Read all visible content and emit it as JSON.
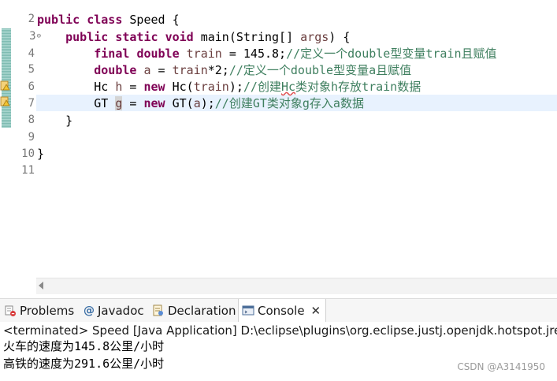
{
  "editor": {
    "line_numbers": [
      "2",
      "3",
      "4",
      "5",
      "6",
      "7",
      "8",
      "9",
      "10",
      "11"
    ],
    "lines": {
      "l2": {
        "kw1": "public",
        "kw2": "class",
        "rest": " Speed {"
      },
      "l3": {
        "indent": "    ",
        "kw1": "public",
        "kw2": "static",
        "kw3": "void",
        "rest": " main(String[] ",
        "param": "args",
        "tail": ") {"
      },
      "l4": {
        "indent": "        ",
        "kw1": "final",
        "kw2": "double",
        "var": "train",
        "mid": " = 145.8;",
        "comment": "//定义一个double型变量train且赋值"
      },
      "l5": {
        "indent": "        ",
        "kw1": "double",
        "var": "a",
        "mid1": " = ",
        "var2": "train",
        "mid2": "*2;",
        "comment": "//定义一个double型变量a且赋值"
      },
      "l6": {
        "indent": "        ",
        "type": "Hc ",
        "var": "h",
        "mid1": " = ",
        "kw1": "new",
        "mid2": " Hc(",
        "var2": "train",
        "mid3": ");",
        "comment_a": "//创建",
        "comment_sq": "Hc",
        "comment_b": "类对象h存放train数据"
      },
      "l7": {
        "indent": "        ",
        "type": "GT ",
        "var": "g",
        "mid1": " = ",
        "kw1": "new",
        "mid2": " GT(",
        "var2": "a",
        "mid3": ");",
        "comment": "//创建GT类对象g存入a数据"
      },
      "l8": {
        "text": "    }"
      },
      "l10": {
        "text": "}"
      }
    }
  },
  "tabs": [
    {
      "label": "Problems",
      "icon": "problems-icon"
    },
    {
      "label": "Javadoc",
      "icon": "at-icon"
    },
    {
      "label": "Declaration",
      "icon": "declaration-icon"
    },
    {
      "label": "Console",
      "icon": "console-icon",
      "active": true
    }
  ],
  "console": {
    "status": "<terminated> Speed [Java Application] D:\\eclipse\\plugins\\org.eclipse.justj.openjdk.hotspot.jre.fu",
    "output": [
      "火车的速度为145.8公里/小时",
      "高铁的速度为291.6公里/小时"
    ]
  },
  "watermark": "CSDN @A3141950",
  "colors": {
    "keyword": "#7f0055",
    "comment": "#3f7f5f",
    "variable": "#6a3e3e",
    "current_line": "#e8f2fe"
  }
}
